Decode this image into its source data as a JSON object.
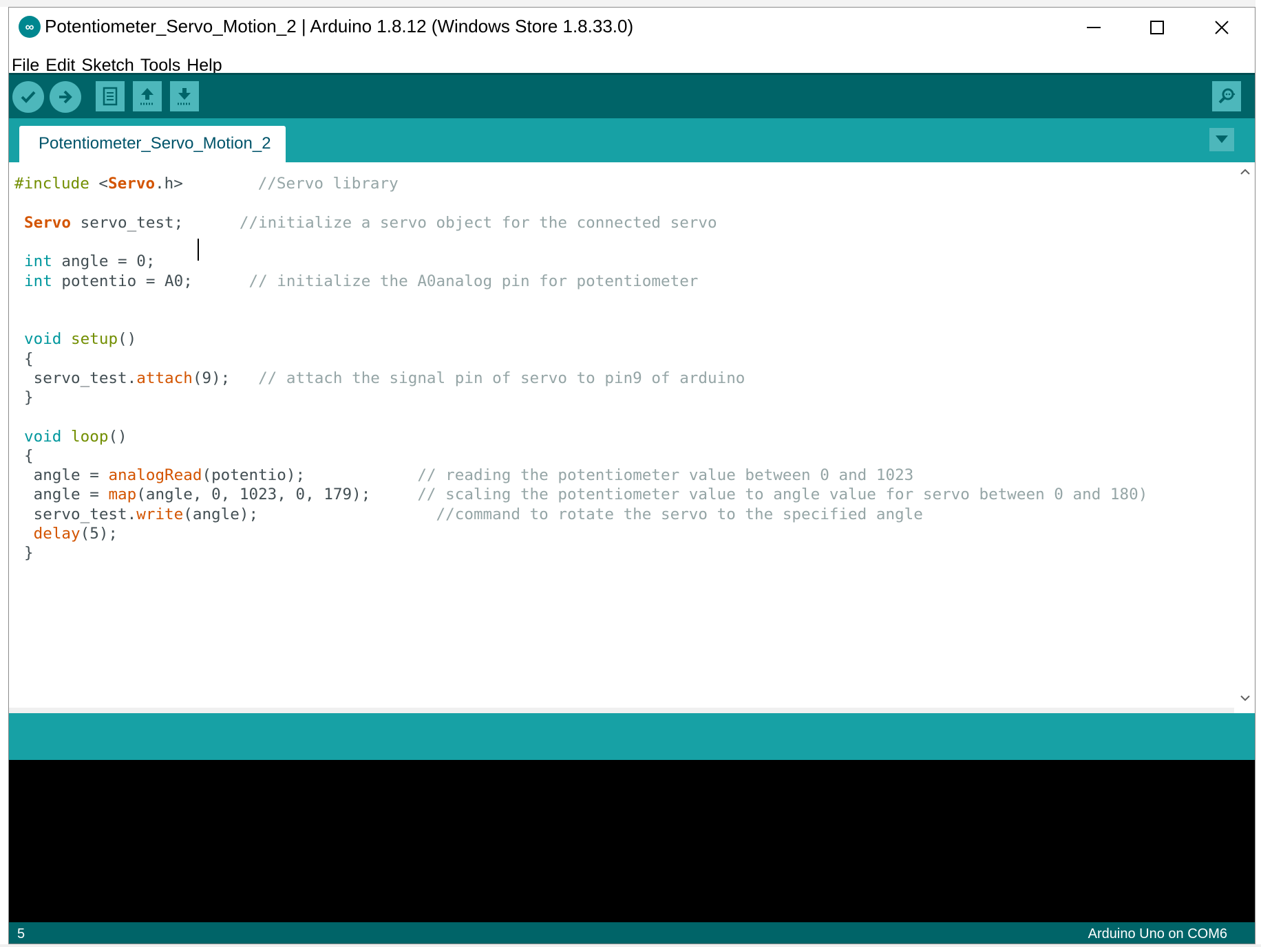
{
  "window": {
    "title": "Potentiometer_Servo_Motion_2 | Arduino 1.8.12 (Windows Store 1.8.33.0)",
    "logo_icon": "arduino-infinity-icon",
    "controls": [
      "minimize-icon",
      "maximize-icon",
      "close-icon"
    ]
  },
  "menu": {
    "file": "File",
    "edit": "Edit",
    "sketch": "Sketch",
    "tools": "Tools",
    "help": "Help"
  },
  "toolbar": {
    "buttons": [
      "verify-icon",
      "upload-icon",
      "new-icon",
      "open-icon",
      "save-icon"
    ],
    "serial_monitor": "serial-monitor-icon"
  },
  "tabs": [
    {
      "label": "Potentiometer_Servo_Motion_2",
      "active": true
    }
  ],
  "status": {
    "line_number": "5",
    "board": "Arduino Uno on COM6"
  },
  "colors": {
    "toolbar": "#006468",
    "tabbar": "#17a1a5",
    "keyword": "#00979d",
    "function": "#d35400",
    "preprocessor": "#728e00",
    "comment": "#95a5a6",
    "console": "#000000"
  }
}
